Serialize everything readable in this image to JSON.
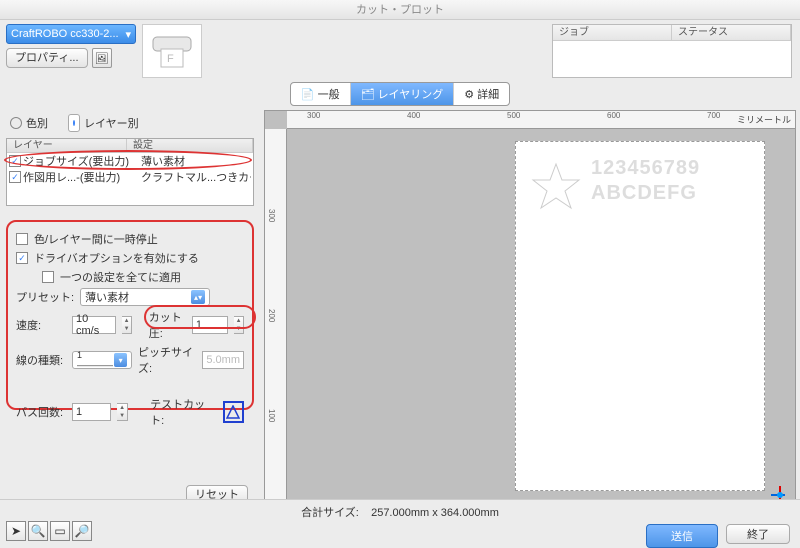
{
  "title": "カット・プロット",
  "device": "CraftROBO cc330-2...",
  "properties_btn": "プロパティ...",
  "jobs": {
    "col1": "ジョブ",
    "col2": "ステータス"
  },
  "tabs": {
    "general": "一般",
    "layering": "レイヤリング",
    "detail": "詳細"
  },
  "mode": {
    "by_color": "色別",
    "by_layer": "レイヤー別"
  },
  "layer_table": {
    "h1": "レイヤー",
    "h2": "設定",
    "rows": [
      {
        "c1": "ジョブサイズ(要出力)",
        "c2": "薄い素材"
      },
      {
        "c1": "作図用レ...-(要出力)",
        "c2": "クラフトマル...つきカード"
      }
    ]
  },
  "opts": {
    "pause": "色/レイヤー間に一時停止",
    "enable_driver": "ドライバオプションを有効にする",
    "apply_all": "一つの設定を全てに適用",
    "preset_lbl": "プリセット:",
    "preset_val": "薄い素材",
    "speed_lbl": "速度:",
    "speed_val": "10 cm/s",
    "pressure_lbl": "カット圧:",
    "pressure_val": "1",
    "line_lbl": "線の種類:",
    "line_val": "1————",
    "pitch_lbl": "ピッチサイズ:",
    "pitch_val": "5.0mm",
    "passes_lbl": "パス回数:",
    "passes_val": "1",
    "testcut_lbl": "テストカット:"
  },
  "reset": "リセット",
  "ruler_unit": "ミリメートル",
  "ruler_ticks_h": [
    "300",
    "400",
    "500",
    "600",
    "700"
  ],
  "ruler_ticks_v": [
    "100",
    "200",
    "300"
  ],
  "preview": {
    "line1": "123456789",
    "line2": "ABCDEFG"
  },
  "total_size_lbl": "合計サイズ:",
  "total_size_val": "257.000mm x 364.000mm",
  "send": "送信",
  "done": "終了",
  "chart_data": null
}
